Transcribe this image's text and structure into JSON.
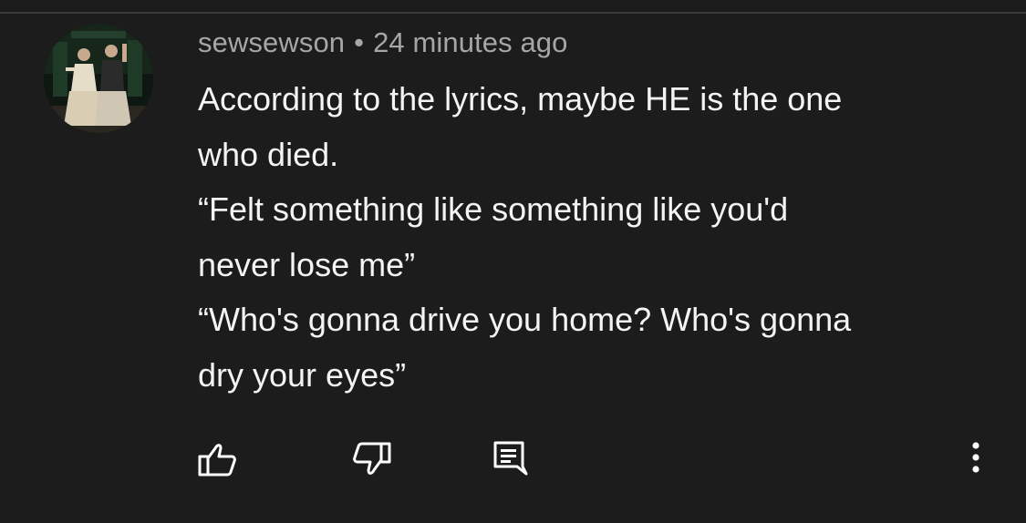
{
  "comment": {
    "author": "sewsewson",
    "separator": "•",
    "timestamp": "24 minutes ago",
    "lines": [
      "According to the lyrics, maybe HE is the one",
      "who died.",
      "“Felt something like something like you'd",
      "never lose me”",
      "“Who's gonna drive you home? Who's gonna",
      "dry your eyes”"
    ]
  },
  "actions": {
    "like": {
      "icon": "thumbs-up-icon"
    },
    "dislike": {
      "icon": "thumbs-down-icon"
    },
    "reply": {
      "icon": "reply-comment-icon"
    },
    "more": {
      "icon": "vertical-ellipsis-icon"
    }
  },
  "colors": {
    "background": "#1c1c1c",
    "meta_text": "#a6a6a6",
    "body_text": "#f4f4f4",
    "divider": "#3a3a3a",
    "icon": "#ffffff"
  }
}
